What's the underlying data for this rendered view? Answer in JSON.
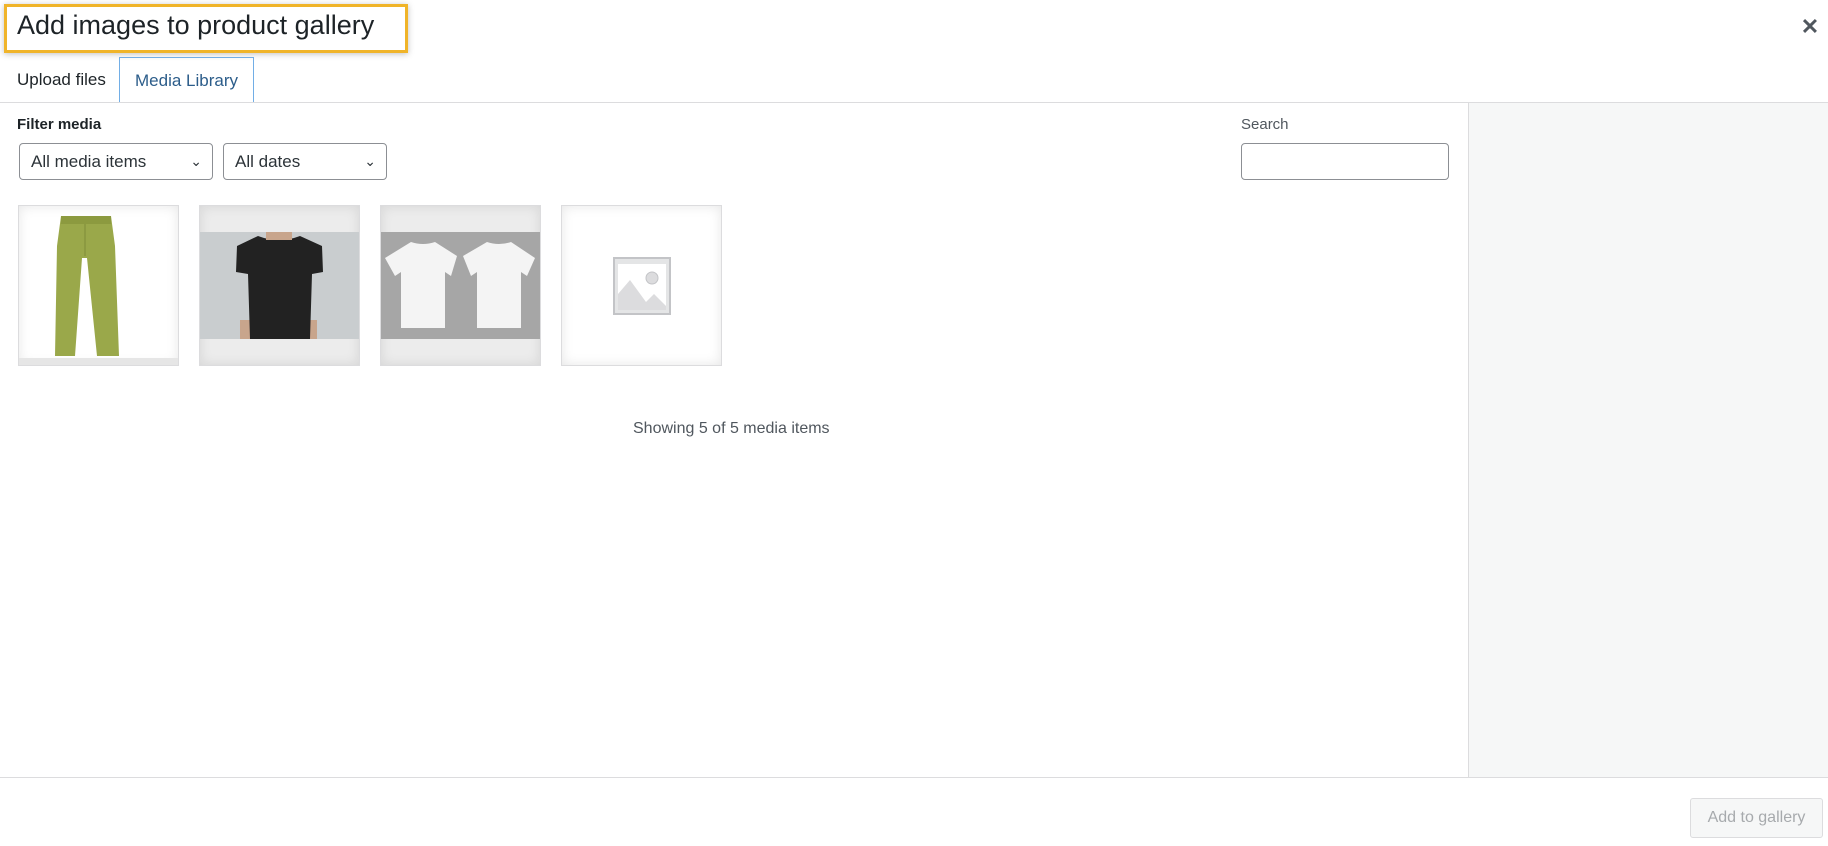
{
  "header": {
    "title": "Add images to product gallery",
    "close_icon": "close-icon"
  },
  "tabs": [
    {
      "label": "Upload files",
      "active": false
    },
    {
      "label": "Media Library",
      "active": true
    }
  ],
  "filters": {
    "label": "Filter media",
    "type_select": {
      "value": "All media items"
    },
    "date_select": {
      "value": "All dates"
    }
  },
  "search": {
    "label": "Search",
    "value": "",
    "placeholder": ""
  },
  "media_items": [
    {
      "description": "Green pants"
    },
    {
      "description": "Black t-shirt on person"
    },
    {
      "description": "Two white t-shirts"
    },
    {
      "description": "Placeholder image"
    }
  ],
  "status_text": "Showing 5 of 5 media items",
  "footer": {
    "add_button_label": "Add to gallery",
    "add_button_disabled": true
  },
  "colors": {
    "highlight": "#f0b429",
    "active_tab_border": "#72aee6",
    "active_tab_text": "#2c5d8a",
    "sidebar_bg": "#f6f7f7"
  }
}
